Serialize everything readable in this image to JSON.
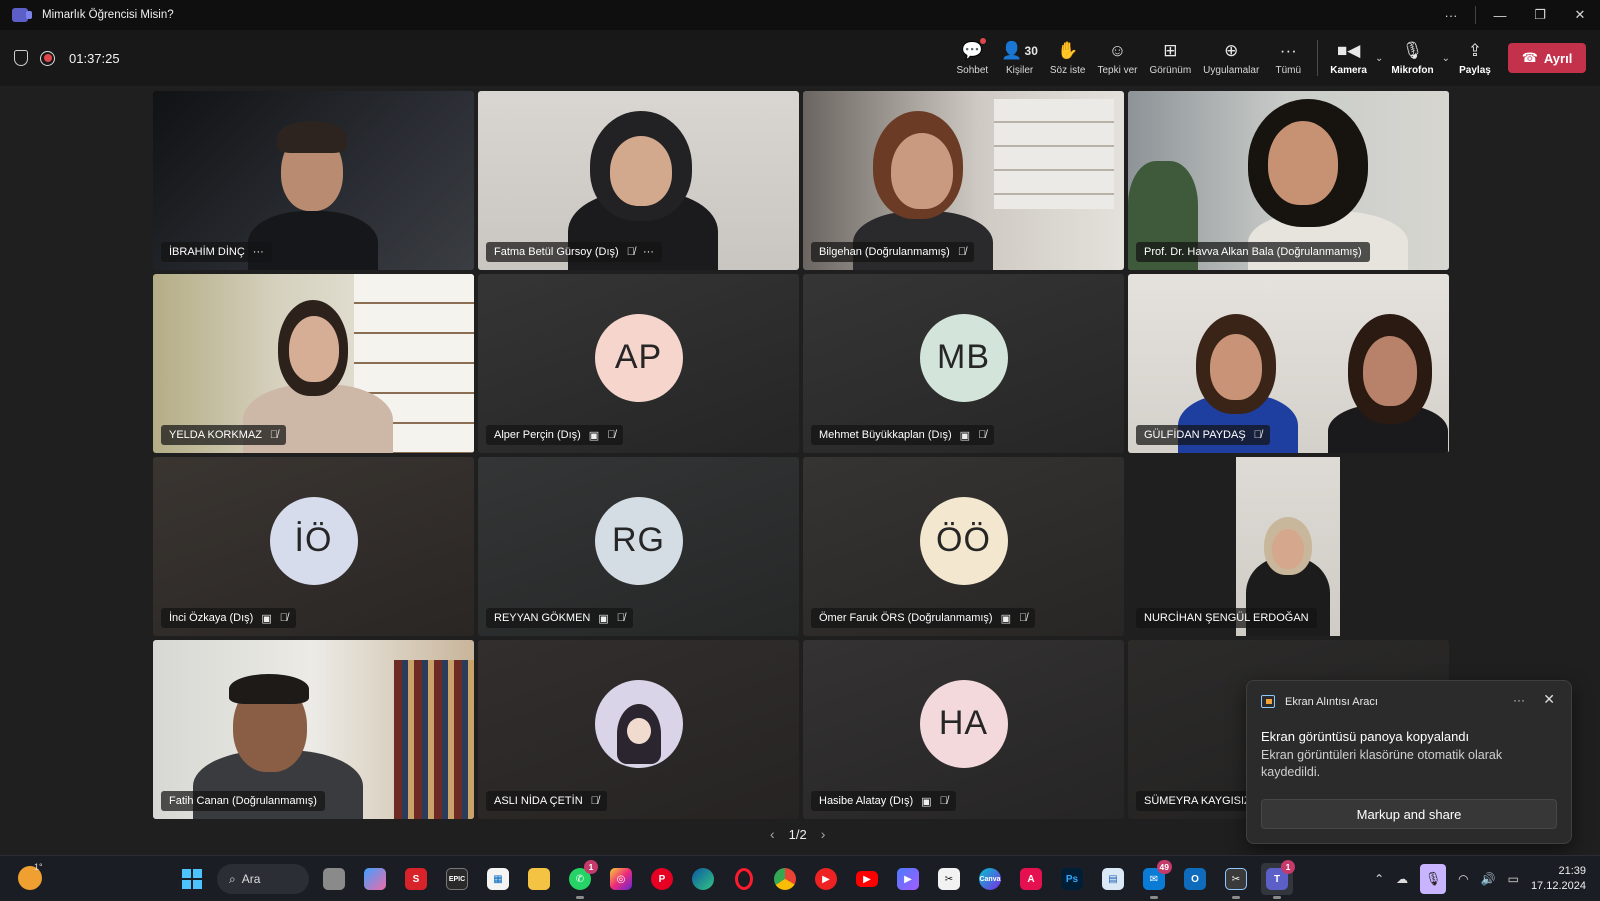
{
  "window": {
    "title": "Mimarlık Öğrencisi Misin?"
  },
  "meeting": {
    "timer": "01:37:25",
    "toolbar": [
      {
        "id": "chat",
        "label": "Sohbet",
        "icon": "chat-icon"
      },
      {
        "id": "people",
        "label": "Kişiler",
        "icon": "people-icon",
        "count": "30"
      },
      {
        "id": "raise",
        "label": "Söz iste",
        "icon": "raise-hand-icon"
      },
      {
        "id": "react",
        "label": "Tepki ver",
        "icon": "smiley-icon"
      },
      {
        "id": "view",
        "label": "Görünüm",
        "icon": "grid-icon"
      },
      {
        "id": "apps",
        "label": "Uygulamalar",
        "icon": "plus-box-icon"
      },
      {
        "id": "more",
        "label": "Tümü",
        "icon": "more-icon"
      }
    ],
    "camera_label": "Kamera",
    "mic_label": "Mikrofon",
    "share_label": "Paylaş",
    "leave_label": "Ayrıl"
  },
  "participants": [
    {
      "name": "İBRAHİM DİNÇ",
      "type": "video",
      "more": true
    },
    {
      "name": "Fatma Betül Gürsoy (Dış)",
      "type": "video",
      "muted": true,
      "more": true
    },
    {
      "name": "Bilgehan (Doğrulanmamış)",
      "type": "video",
      "muted": true
    },
    {
      "name": "Prof. Dr. Havva Alkan Bala (Doğrulanmamış)",
      "type": "video",
      "active": true
    },
    {
      "name": "YELDA KORKMAZ",
      "type": "video",
      "muted": true
    },
    {
      "name": "Alper Perçin (Dış)",
      "type": "avatar",
      "initials": "AP",
      "color": "#f5d5cc",
      "muted": true,
      "camoff": true
    },
    {
      "name": "Mehmet Büyükkaplan (Dış)",
      "type": "avatar",
      "initials": "MB",
      "color": "#d3e5da",
      "muted": true,
      "camoff": true
    },
    {
      "name": "GÜLFİDAN PAYDAŞ",
      "type": "video",
      "muted": true
    },
    {
      "name": "İnci Özkaya (Dış)",
      "type": "avatar",
      "initials": "İÖ",
      "color": "#d6dcec",
      "muted": true,
      "camoff": true
    },
    {
      "name": "REYYAN GÖKMEN",
      "type": "avatar",
      "initials": "RG",
      "color": "#d5dde4",
      "muted": true,
      "camoff": true
    },
    {
      "name": "Ömer Faruk ÖRS (Doğrulanmamış)",
      "type": "avatar",
      "initials": "ÖÖ",
      "color": "#f3e8cf",
      "muted": true,
      "camoff": true
    },
    {
      "name": "NURCİHAN ŞENGÜL ERDOĞAN",
      "type": "video"
    },
    {
      "name": "Fatih Canan (Doğrulanmamış)",
      "type": "video"
    },
    {
      "name": "ASLI NİDA ÇETİN",
      "type": "picture",
      "muted": true
    },
    {
      "name": "Hasibe Alatay (Dış)",
      "type": "avatar",
      "initials": "HA",
      "color": "#f3d9dc",
      "muted": true,
      "camoff": true
    },
    {
      "name": "SÜMEYRA KAYGISIZ",
      "type": "dark"
    }
  ],
  "pager": {
    "label": "1/2"
  },
  "toast": {
    "app": "Ekran Alıntısı Aracı",
    "title": "Ekran görüntüsü panoya kopyalandı",
    "body": "Ekran görüntüleri klasörüne otomatik olarak kaydedildi.",
    "button": "Markup and share"
  },
  "taskbar": {
    "weather_temp": "1°",
    "search_label": "Ara",
    "whatsapp_badge": "1",
    "mail_badge": "49",
    "teams_badge": "1",
    "time": "21:39",
    "date": "17.12.2024"
  }
}
